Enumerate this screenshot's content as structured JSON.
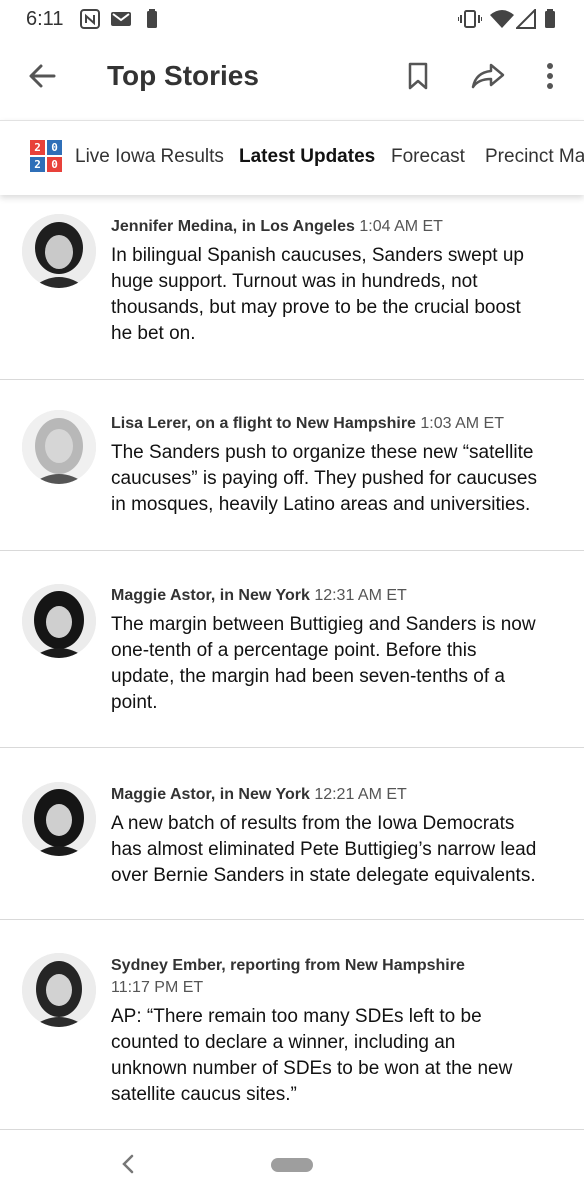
{
  "status_bar": {
    "time": "6:11",
    "left_icons": [
      "nyt-notification-icon",
      "gmail-icon",
      "battery-saver-icon"
    ],
    "right_icons": [
      "vibrate-icon",
      "wifi-icon",
      "signal-icon",
      "battery-icon"
    ]
  },
  "app_bar": {
    "title": "Top Stories",
    "icons": [
      "back-arrow-icon",
      "bookmark-icon",
      "share-icon",
      "more-vert-icon"
    ]
  },
  "tabs": [
    {
      "label": "Live Iowa Results",
      "active": false
    },
    {
      "label": "Latest Updates",
      "active": true
    },
    {
      "label": "Forecast",
      "active": false
    },
    {
      "label": "Precinct Ma",
      "active": false
    }
  ],
  "logo": {
    "digits": [
      "2",
      "0",
      "2",
      "0"
    ],
    "colors": [
      "#e8413a",
      "#2f6fb8",
      "#2f6fb8",
      "#e8413a"
    ]
  },
  "updates": [
    {
      "author": "Jennifer Medina, in Los Angeles",
      "time": "1:04 AM ET",
      "lines": [
        "In bilingual Spanish caucuses, Sanders swept up",
        "huge support. Turnout was in hundreds, not",
        "thousands, but may prove to be the crucial boost",
        "he bet on."
      ]
    },
    {
      "author": "Lisa Lerer, on a flight to New Hampshire",
      "time": "1:03 AM ET",
      "lines": [
        "The Sanders push to organize these new “satellite",
        "caucuses” is paying off. They pushed for caucuses",
        "in mosques, heavily Latino areas and universities."
      ]
    },
    {
      "author": "Maggie Astor, in New York",
      "time": "12:31 AM ET",
      "lines": [
        "The margin between Buttigieg and Sanders is now",
        "one-tenth of a percentage point. Before this",
        "update, the margin had been seven-tenths of a",
        "point."
      ]
    },
    {
      "author": "Maggie Astor, in New York",
      "time": "12:21 AM ET",
      "lines": [
        "A new batch of results from the Iowa Democrats",
        "has almost eliminated Pete Buttigieg’s narrow lead",
        "over Bernie Sanders in state delegate equivalents."
      ]
    },
    {
      "author": "Sydney Ember, reporting from New Hampshire",
      "time": "11:17 PM ET",
      "lines": [
        "AP: “There remain too many SDEs left to be",
        "counted to declare a winner, including an",
        "unknown number of SDEs to be won at the new",
        "satellite caucus sites.”"
      ]
    }
  ],
  "nav_bar": {
    "icons": [
      "back-chevron-icon",
      "home-pill-icon"
    ]
  }
}
